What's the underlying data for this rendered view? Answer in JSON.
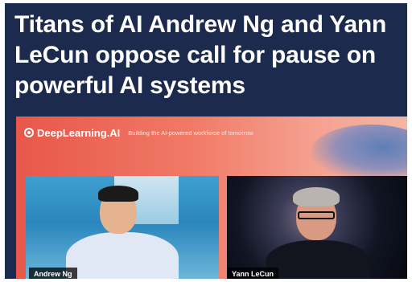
{
  "headline": "Titans of AI Andrew Ng and Yann LeCun oppose call for pause on powerful AI systems",
  "video": {
    "brand_name": "DeepLearning.AI",
    "tagline": "Building the AI-powered workforce of tomorrow",
    "participants": [
      {
        "name": "Andrew Ng"
      },
      {
        "name": "Yann LeCun"
      }
    ]
  },
  "colors": {
    "card_background": "#1c2a4d",
    "headline_text": "#ffffff",
    "video_gradient_start": "#e8574a",
    "video_gradient_end": "#f4b6a4"
  }
}
